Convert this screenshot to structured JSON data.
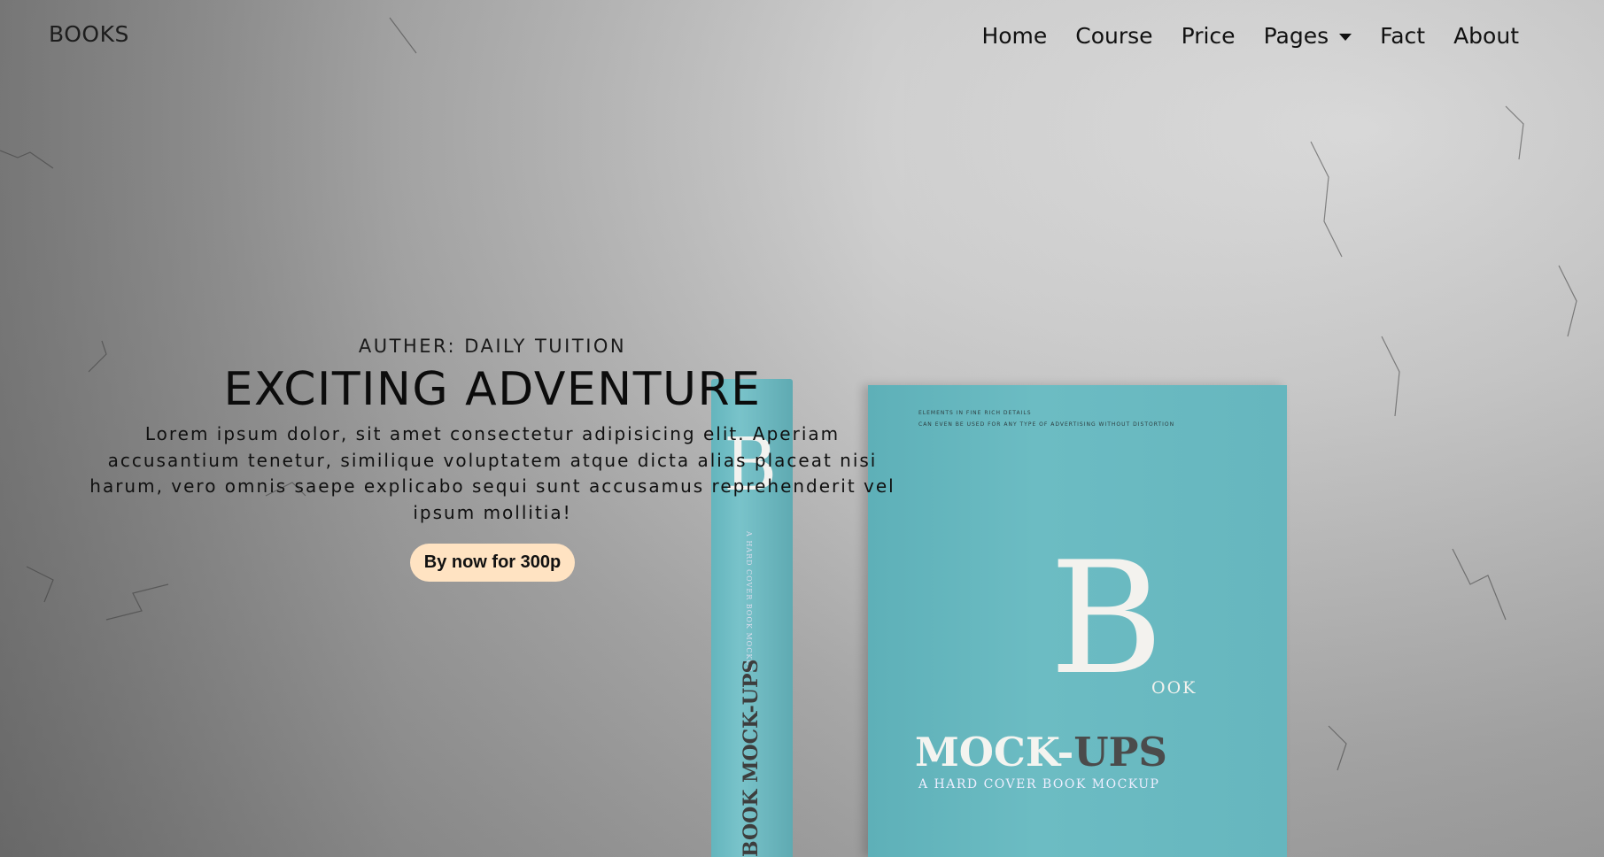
{
  "nav": {
    "brand": "BOOKS",
    "items": [
      {
        "label": "Home"
      },
      {
        "label": "Course"
      },
      {
        "label": "Price"
      },
      {
        "label": "Pages",
        "dropdown": true
      },
      {
        "label": "Fact"
      },
      {
        "label": "About"
      }
    ]
  },
  "hero": {
    "author": "AUTHER: DAILY TUITION",
    "headline": "EXCITING ADVENTURE",
    "description": "Lorem ipsum dolor, sit amet consectetur adipisicing elit. Aperiam accusantium tenetur, similique voluptatem atque dicta alias placeat nisi harum, vero omnis saepe explicabo sequi sunt accusamus reprehenderit vel ipsum mollitia!",
    "button_label": "By now for 300p"
  },
  "book_image": {
    "spine_letter": "B",
    "spine_small": "A HARD COVER BOOK MOCKUP",
    "spine_title": "BOOK MOCK-UPS",
    "cover_fine_1": "ELEMENTS IN FINE RICH DETAILS",
    "cover_fine_2": "CAN EVEN BE USED FOR ANY TYPE OF ADVERTISING WITHOUT DISTORTION",
    "cover_letter": "B",
    "cover_letter_suffix": "OOK",
    "cover_title_light": "MOCK-",
    "cover_title_dark": "UPS",
    "cover_subtitle": "A HARD COVER BOOK MOCKUP"
  },
  "colors": {
    "button_bg": "#ffe3c2",
    "book_teal": "#66b6be",
    "text_dark": "#111111"
  }
}
